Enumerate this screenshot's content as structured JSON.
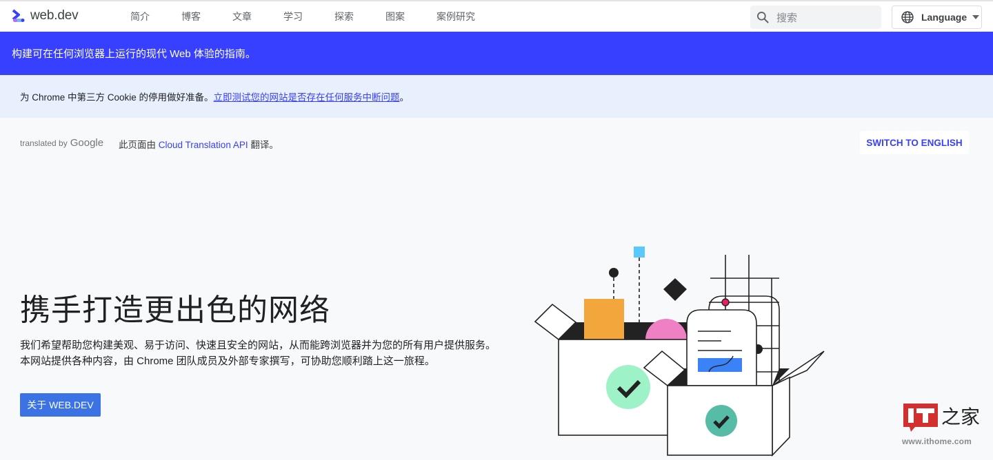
{
  "header": {
    "site_name": "web.dev",
    "nav": [
      {
        "label": "简介"
      },
      {
        "label": "博客"
      },
      {
        "label": "文章"
      },
      {
        "label": "学习"
      },
      {
        "label": "探索"
      },
      {
        "label": "图案"
      },
      {
        "label": "案例研究"
      }
    ],
    "search": {
      "placeholder": "搜索",
      "icon": "search-icon"
    },
    "language": {
      "label": "Language",
      "icon": "globe-icon"
    }
  },
  "banner": {
    "text": "构建可在任何浏览器上运行的现代 Web 体验的指南。",
    "color": "#3740ff"
  },
  "notice": {
    "text": "为 Chrome 中第三方 Cookie 的停用做好准备。",
    "link": "立即测试您的网站是否存在任何服务中断问题",
    "suffix": "。"
  },
  "translation": {
    "translated_by": "translated by",
    "brand": "Google",
    "note_prefix": "此页面由 ",
    "note_link": "Cloud Translation API",
    "note_suffix": " 翻译。",
    "switch_button": "SWITCH TO ENGLISH"
  },
  "hero": {
    "title": "携手打造更出色的网络",
    "description": "我们希望帮助您构建美观、易于访问、快速且安全的网站，从而能跨浏览器并为您的所有用户提供服务。本网站提供各种内容，由 Chrome 团队成员及外部专家撰写，可协助您顺利踏上这一旅程。",
    "button": "关于 WEB.DEV"
  },
  "watermark": {
    "brand": "IT之家",
    "url": "www.ithome.com"
  },
  "colors": {
    "accent": "#3740ff",
    "button": "#3b73e5",
    "notice_bg": "#e8f0fe",
    "orange": "#f2a63b",
    "pink": "#ef80c3",
    "light_blue": "#5ac8fa",
    "mint": "#9ef2c8",
    "teal": "#57bca6",
    "doc_blue": "#3b82f6",
    "red_dot": "#e91e63"
  }
}
